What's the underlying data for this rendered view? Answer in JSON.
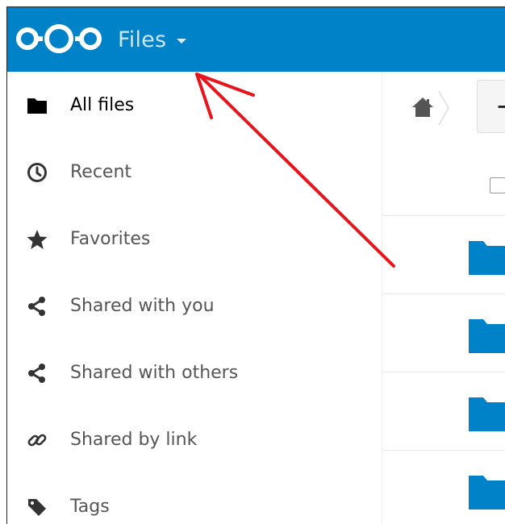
{
  "app": {
    "title": "Files",
    "accent_color": "#0082c9",
    "logo_icon": "nextcloud-logo",
    "menu_icon": "caret-down-icon"
  },
  "sidebar": {
    "items": [
      {
        "label": "All files",
        "icon": "folder-icon",
        "active": true
      },
      {
        "label": "Recent",
        "icon": "clock-icon"
      },
      {
        "label": "Favorites",
        "icon": "star-icon"
      },
      {
        "label": "Shared with you",
        "icon": "share-icon"
      },
      {
        "label": "Shared with others",
        "icon": "share-icon"
      },
      {
        "label": "Shared by link",
        "icon": "link-icon"
      },
      {
        "label": "Tags",
        "icon": "tag-icon"
      }
    ]
  },
  "content": {
    "home_icon": "home-icon",
    "new_button_label": "+",
    "folder_color": "#0082c9",
    "rows": [
      {
        "icon": "folder-icon"
      },
      {
        "icon": "folder-icon"
      },
      {
        "icon": "folder-icon"
      },
      {
        "icon": "folder-icon"
      }
    ]
  },
  "annotation": {
    "arrow_color": "#e8141c",
    "points_to": "app-menu"
  }
}
